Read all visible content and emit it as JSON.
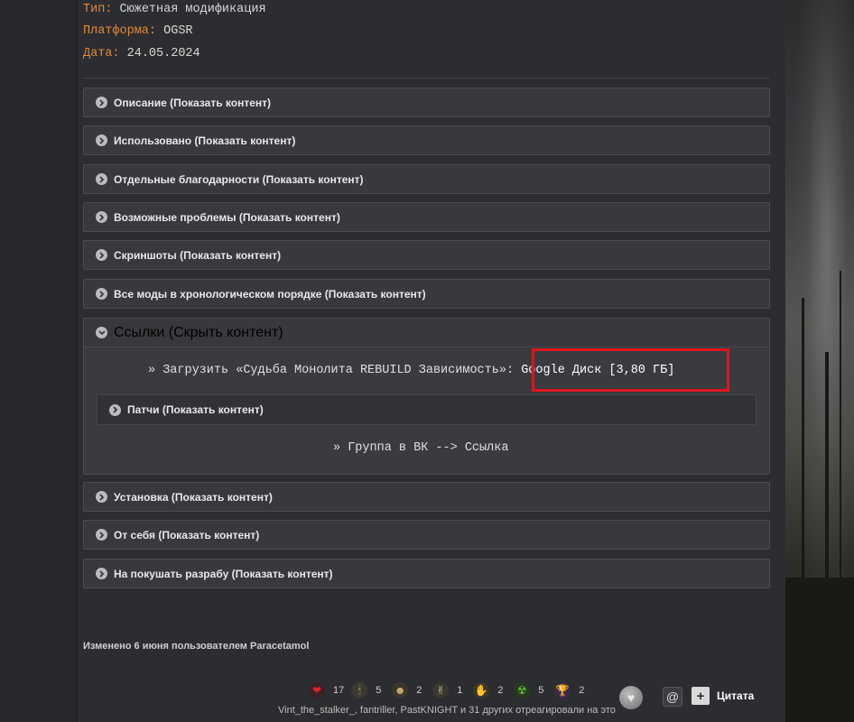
{
  "meta": {
    "type_label": "Тип:",
    "type_value": "Сюжетная модификация",
    "platform_label": "Платформа:",
    "platform_value": "OGSR",
    "date_label": "Дата:",
    "date_value": "24.05.2024"
  },
  "spoilers_top": [
    {
      "label": "Описание (Показать контент)"
    },
    {
      "label": "Использовано (Показать контент)"
    },
    {
      "label": "Отдельные благодарности (Показать контент)"
    },
    {
      "label": "Возможные проблемы (Показать контент)"
    },
    {
      "label": "Скриншоты (Показать контент)"
    },
    {
      "label": "Все моды в хронологическом порядке (Показать контент)"
    }
  ],
  "links_spoiler": {
    "label": "Ссылки (Скрыть контент)",
    "download_prefix": "» Загрузить «Судьба Монолита REBUILD Зависимость»:",
    "download_link": "Google Диск [3,80 ГБ]",
    "nested_label": "Патчи (Показать контент)",
    "vk_line": "» Группа в ВК --> Ссылка"
  },
  "spoilers_bottom": [
    {
      "label": "Установка (Показать контент)"
    },
    {
      "label": "От себя (Показать контент)"
    },
    {
      "label": "На покушать разрабу (Показать контент)"
    }
  ],
  "edited_note": "Изменено 6 июня пользователем Paracetamol",
  "reactions": [
    {
      "icon": "heart-icon",
      "count": "17",
      "color": "#c8202a"
    },
    {
      "icon": "candle-icon",
      "count": "5",
      "color": "#6b6a55"
    },
    {
      "icon": "smile-icon",
      "count": "2",
      "color": "#7a6a4a"
    },
    {
      "icon": "hands-icon",
      "count": "1",
      "color": "#6a6a60"
    },
    {
      "icon": "gesture-icon",
      "count": "2",
      "color": "#7a6f5a"
    },
    {
      "icon": "radiation-icon",
      "count": "5",
      "color": "#3f7a2a"
    },
    {
      "icon": "trophy-icon",
      "count": "2",
      "color": "#7a4aa0"
    }
  ],
  "reacted_by": "Vint_the_stalker_, fantriller, PastKNIGHT и 31 других отреагировали на это",
  "actions": {
    "mention": "@",
    "quote_plus": "+",
    "quote_label": "Цитата"
  }
}
